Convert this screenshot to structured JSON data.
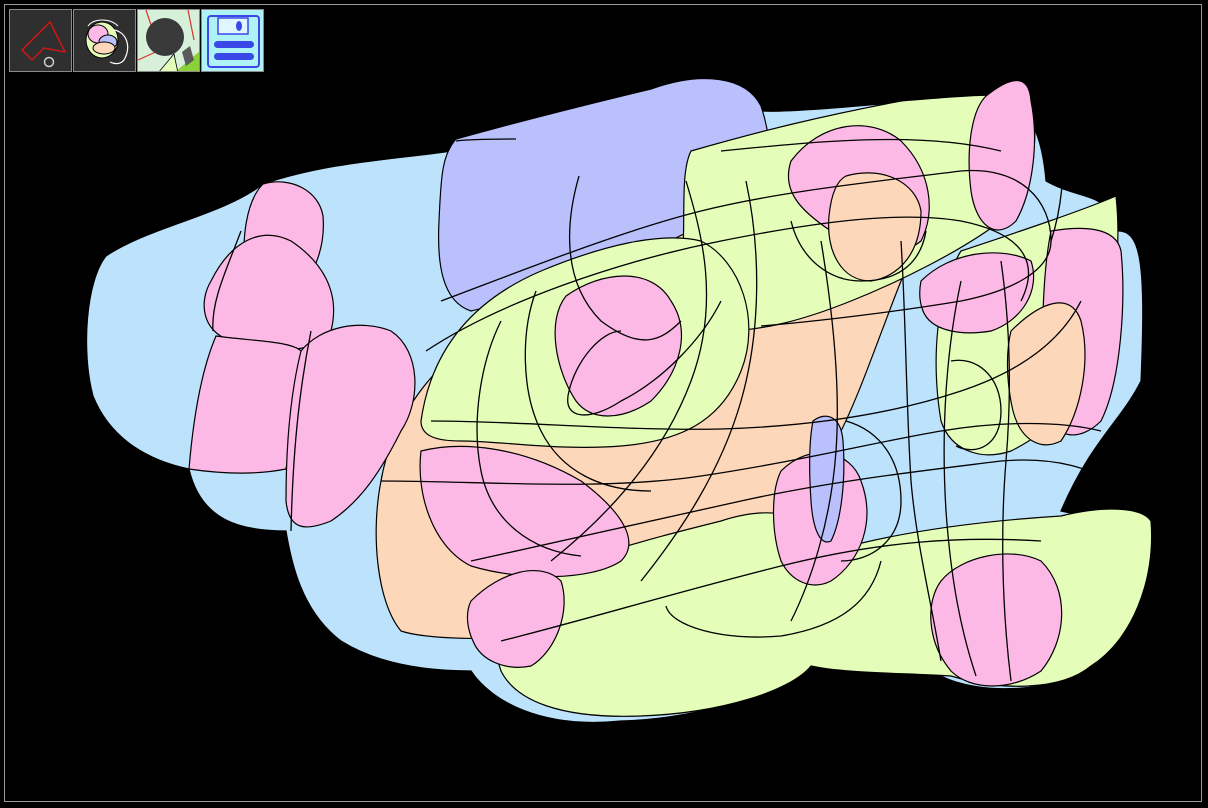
{
  "app": {
    "title": "",
    "background_color": "#000000",
    "frame_color": "#9a9a9a"
  },
  "toolbar": {
    "tools": [
      {
        "name": "draw-line-tool",
        "icon": "polygon-pen-icon",
        "selected": true
      },
      {
        "name": "fill-tool",
        "icon": "colored-scribble-icon",
        "selected": false
      },
      {
        "name": "brush-size-tool",
        "icon": "black-circle-icon",
        "selected": false
      },
      {
        "name": "save-tool",
        "icon": "floppy-disk-icon",
        "selected": false
      }
    ]
  },
  "palette": {
    "blue": "#bde2fc",
    "pink": "#fdb9e5",
    "green": "#e4fdb9",
    "peach": "#fdd7b9",
    "purple": "#b9c0fc",
    "stroke": "#000000"
  }
}
